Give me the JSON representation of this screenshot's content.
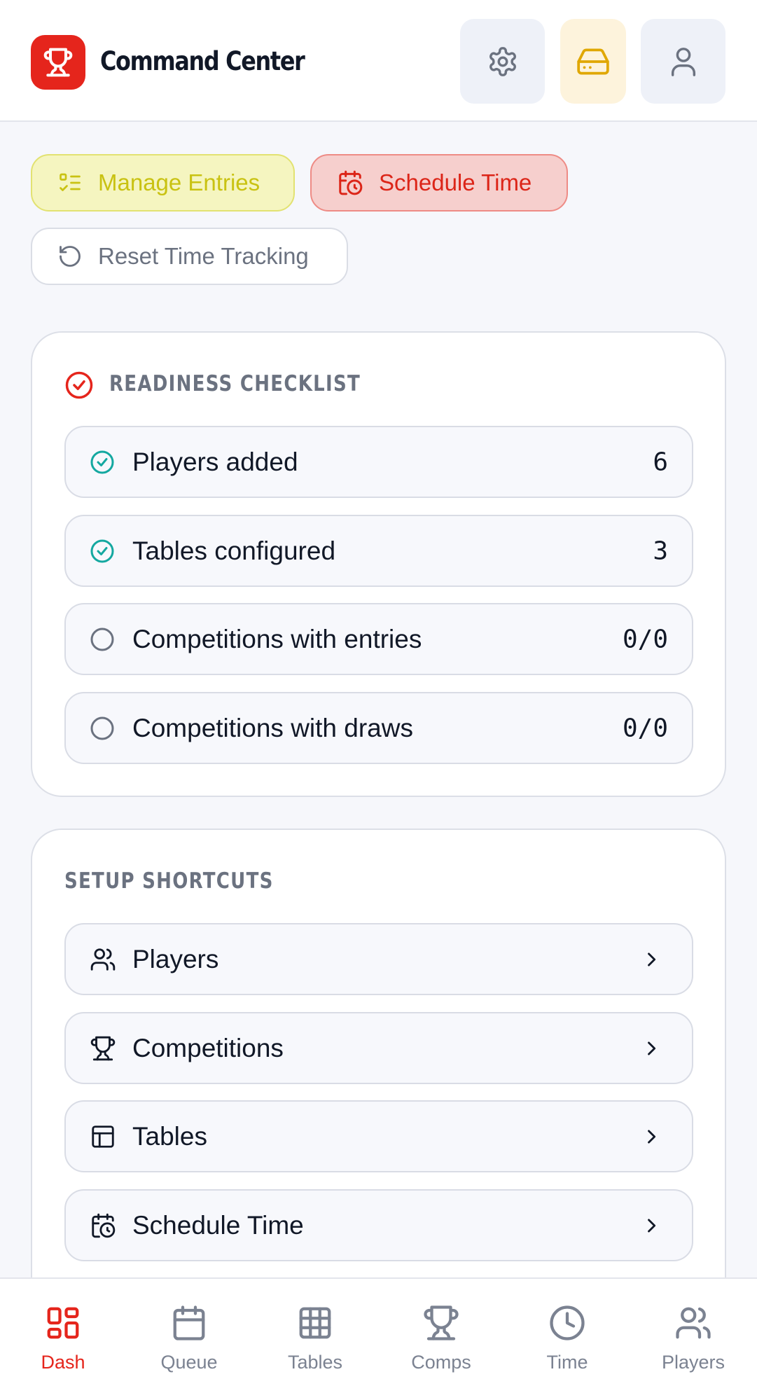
{
  "header": {
    "title": "Command Center",
    "logo_icon": "trophy-icon",
    "buttons": [
      {
        "name": "settings",
        "icon": "gear-icon"
      },
      {
        "name": "storage",
        "icon": "hard-drive-icon"
      },
      {
        "name": "profile",
        "icon": "user-icon"
      }
    ]
  },
  "actions": {
    "manage_entries": "Manage Entries",
    "schedule_time": "Schedule Time",
    "reset_time_tracking": "Reset Time Tracking"
  },
  "checklist": {
    "title": "READINESS CHECKLIST",
    "items": [
      {
        "label": "Players added",
        "value": "6",
        "done": true
      },
      {
        "label": "Tables configured",
        "value": "3",
        "done": true
      },
      {
        "label": "Competitions with entries",
        "value": "0/0",
        "done": false
      },
      {
        "label": "Competitions with draws",
        "value": "0/0",
        "done": false
      }
    ]
  },
  "shortcuts": {
    "title": "SETUP SHORTCUTS",
    "items": [
      {
        "label": "Players",
        "icon": "users-icon"
      },
      {
        "label": "Competitions",
        "icon": "trophy-icon"
      },
      {
        "label": "Tables",
        "icon": "table-layout-icon"
      },
      {
        "label": "Schedule Time",
        "icon": "calendar-clock-icon"
      }
    ]
  },
  "nav": {
    "items": [
      {
        "label": "Dash",
        "icon": "dashboard-icon",
        "active": true
      },
      {
        "label": "Queue",
        "icon": "calendar-icon",
        "active": false
      },
      {
        "label": "Tables",
        "icon": "grid-icon",
        "active": false
      },
      {
        "label": "Comps",
        "icon": "trophy-icon",
        "active": false
      },
      {
        "label": "Time",
        "icon": "clock-icon",
        "active": false
      },
      {
        "label": "Players",
        "icon": "users-icon",
        "active": false
      }
    ]
  },
  "colors": {
    "accent": "#e5251c",
    "check_done": "#14a8a0",
    "manage_text": "#c9c212",
    "storage_icon": "#e0a700"
  }
}
